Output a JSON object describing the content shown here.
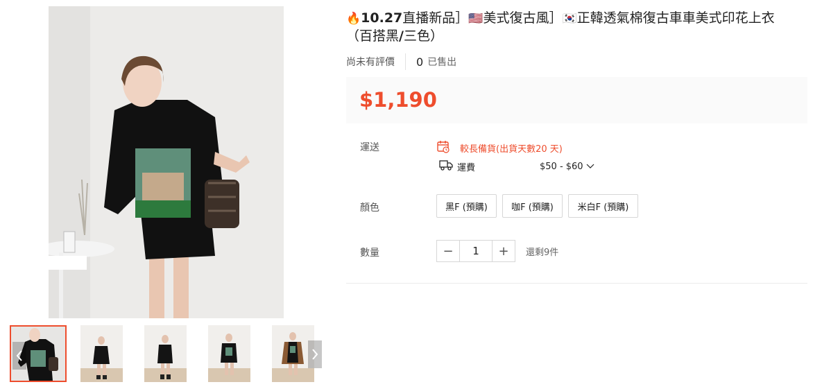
{
  "product": {
    "title_prefix": "🔥",
    "title_part1": "10.27",
    "title_part2": "直播新品］",
    "title_flag_us": "🇺🇸",
    "title_part3": "美式復古風］",
    "title_flag_kr": "🇰🇷",
    "title_part4": "正韓透氣棉復古車車美式印花上衣",
    "title_line2_start": "（百搭黑",
    "title_line2_slash": "/",
    "title_line2_end": "三色）",
    "no_rating": "尚未有評價",
    "sold_count": "0",
    "sold_label": "已售出",
    "price": "$1,190"
  },
  "shipping": {
    "label": "運送",
    "warning": "較長備貨(出貨天數20 天)",
    "fee_label": "運費",
    "fee_range": "$50 - $60"
  },
  "color": {
    "label": "顏色",
    "options": [
      "黑F (預購)",
      "咖F (預購)",
      "米白F (預購)"
    ]
  },
  "quantity": {
    "label": "數量",
    "decrease": "−",
    "value": "1",
    "increase": "+",
    "stock": "還剩9件"
  },
  "icons": {
    "prev": "chevron-left-icon",
    "next": "chevron-right-icon",
    "calendar": "calendar-icon",
    "truck": "truck-icon",
    "dropdown": "chevron-down-icon"
  },
  "colors": {
    "accent": "#ee4d2d",
    "price_bg": "#fafafa"
  }
}
